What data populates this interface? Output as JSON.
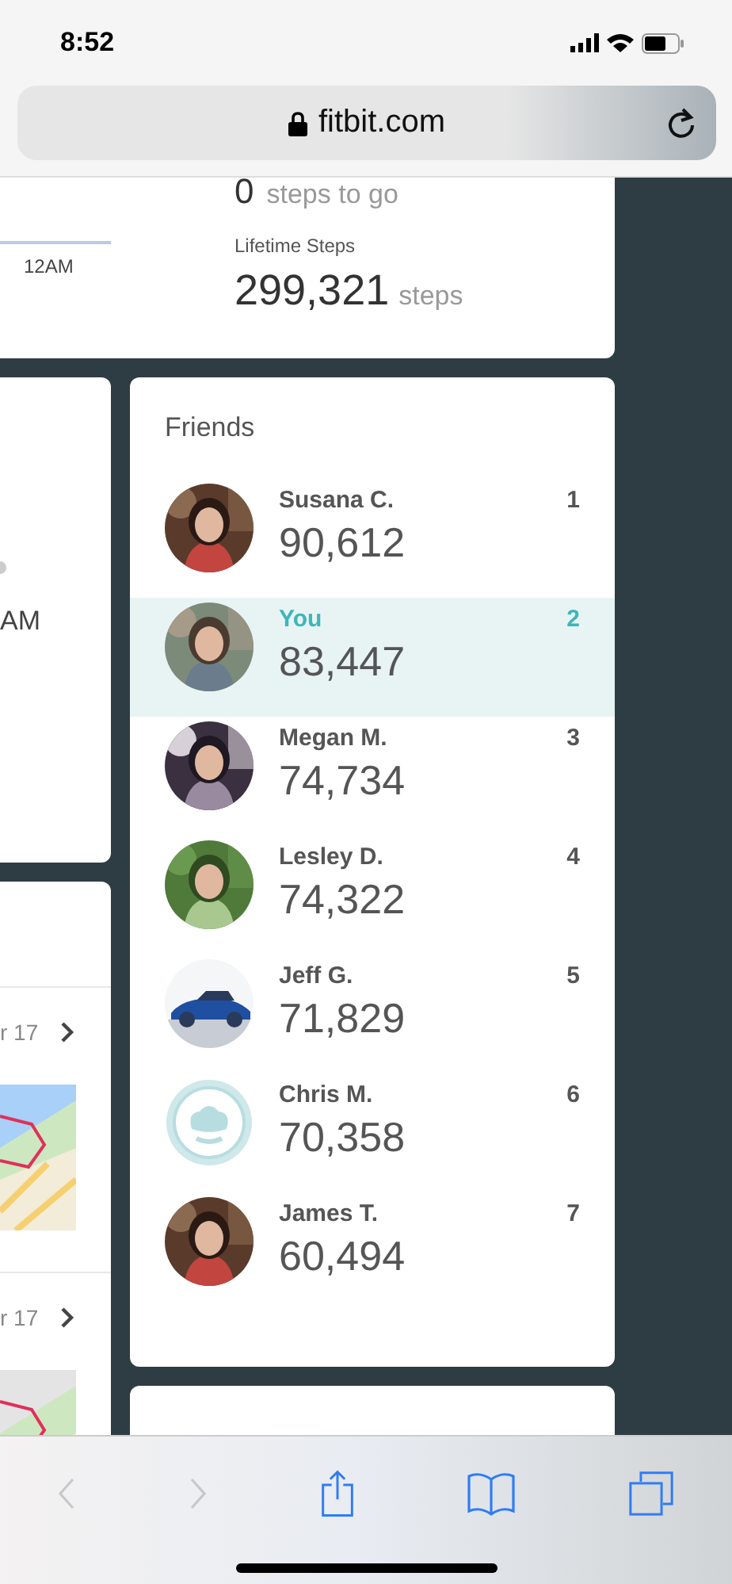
{
  "status_bar": {
    "time": "8:52"
  },
  "address_bar": {
    "url": "fitbit.com"
  },
  "steps_card": {
    "axis_label": "12AM",
    "goal_value": "0",
    "goal_unit": "steps to go",
    "lifetime_label": "Lifetime Steps",
    "lifetime_value": "299,321",
    "lifetime_unit": "steps"
  },
  "hourly_card": {
    "axis_label": "AM"
  },
  "exercise_card": {
    "entries": [
      {
        "date": "r 17"
      },
      {
        "date": "r 17"
      }
    ]
  },
  "friends": {
    "title": "Friends",
    "items": [
      {
        "name": "Susana C.",
        "steps": "90,612",
        "rank": "1",
        "selected": false
      },
      {
        "name": "You",
        "steps": "83,447",
        "rank": "2",
        "selected": true
      },
      {
        "name": "Megan M.",
        "steps": "74,734",
        "rank": "3",
        "selected": false
      },
      {
        "name": "Lesley D.",
        "steps": "74,322",
        "rank": "4",
        "selected": false
      },
      {
        "name": "Jeff G.",
        "steps": "71,829",
        "rank": "5",
        "selected": false
      },
      {
        "name": "Chris M.",
        "steps": "70,358",
        "rank": "6",
        "selected": false,
        "kind": "default"
      },
      {
        "name": "James T.",
        "steps": "60,494",
        "rank": "7",
        "selected": false
      }
    ]
  },
  "toolbar": {
    "buttons": [
      {
        "kind": "back",
        "disabled": true
      },
      {
        "kind": "forward",
        "disabled": true
      },
      {
        "kind": "share",
        "disabled": false
      },
      {
        "kind": "bookmarks",
        "disabled": false
      },
      {
        "kind": "tabs",
        "disabled": false
      }
    ]
  }
}
